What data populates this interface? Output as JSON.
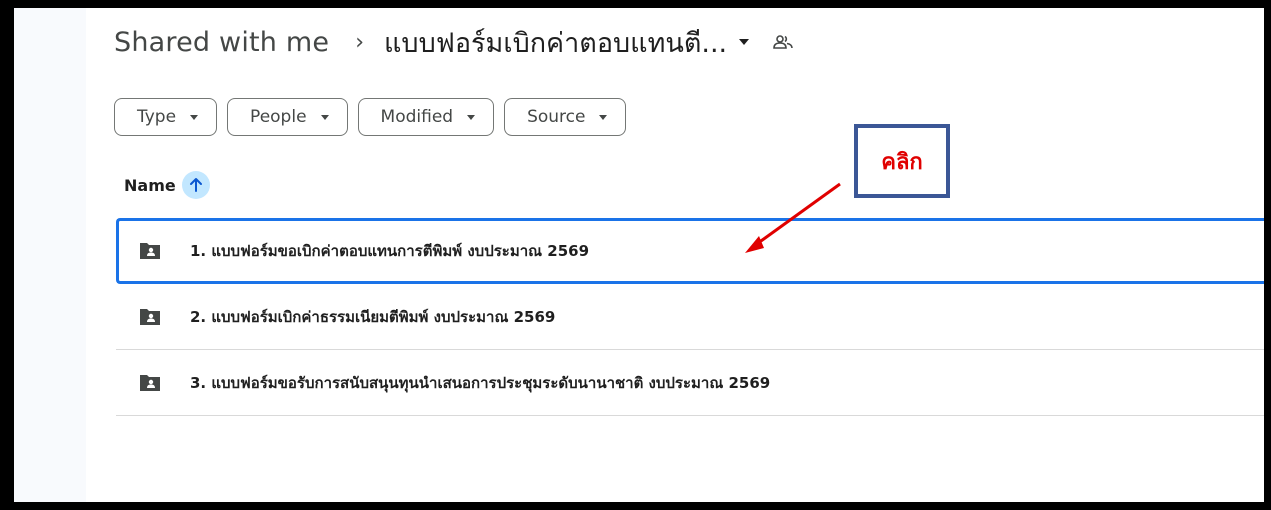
{
  "breadcrumb": {
    "root": "Shared with me",
    "separator": "›",
    "current": "แบบฟอร์มเบิกค่าตอบแทนตี..."
  },
  "filters": [
    {
      "label": "Type"
    },
    {
      "label": "People"
    },
    {
      "label": "Modified"
    },
    {
      "label": "Source"
    }
  ],
  "list": {
    "header": "Name",
    "sort_direction": "ascending",
    "rows": [
      {
        "label": "1. แบบฟอร์มขอเบิกค่าตอบแทนการตีพิมพ์  งบประมาณ 2569",
        "selected": true,
        "icon": "shared-folder-icon"
      },
      {
        "label": "2. แบบฟอร์มเบิกค่าธรรมเนียมตีพิมพ์ งบประมาณ 2569",
        "selected": false,
        "icon": "shared-folder-icon"
      },
      {
        "label": "3. แบบฟอร์มขอรับการสนับสนุนทุนนำเสนอการประชุมระดับนานาชาติ งบประมาณ  2569",
        "selected": false,
        "icon": "shared-folder-icon"
      }
    ]
  },
  "annotation": {
    "text": "คลิก",
    "text_color": "#e00000",
    "box_color": "#3b5796",
    "arrow_color": "#e00000"
  },
  "colors": {
    "selection": "#1a73e8",
    "sort_badge": "#c2e7ff"
  }
}
